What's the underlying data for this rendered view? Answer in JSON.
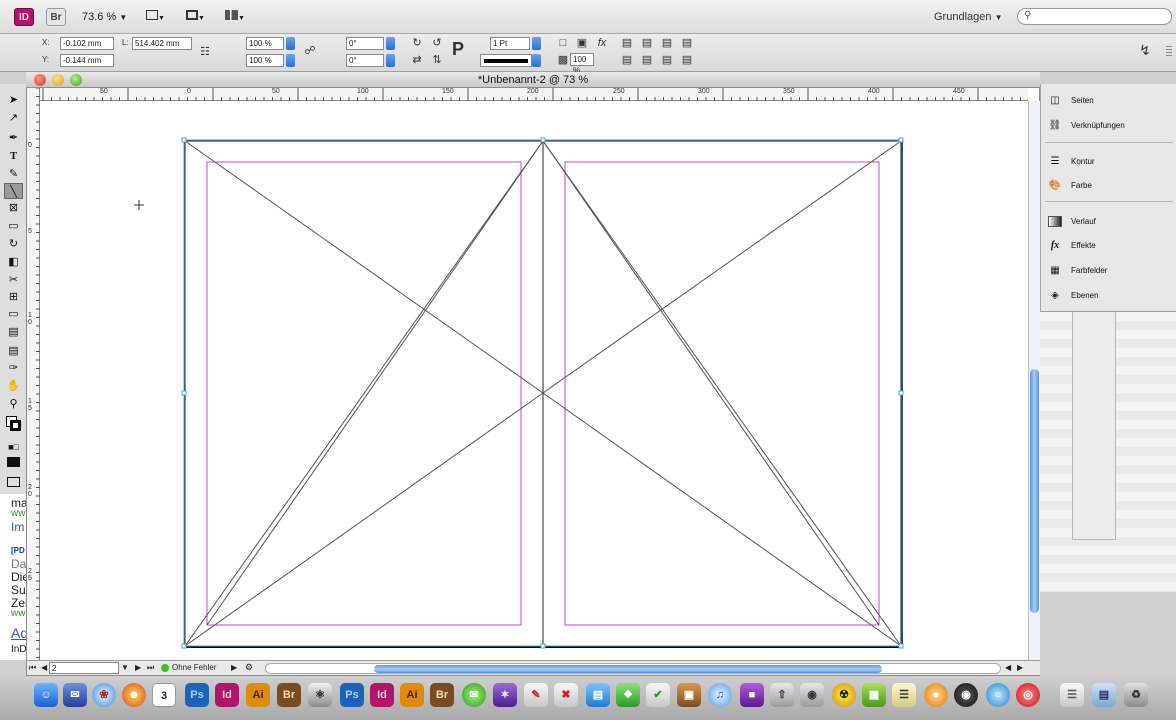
{
  "appbar": {
    "app_icon": "ID",
    "bridge_icon": "Br",
    "zoom": "73.6 %",
    "workspace": "Grundlagen",
    "search_placeholder": ""
  },
  "control": {
    "x_label": "X:",
    "x_value": "-0.102 mm",
    "y_label": "Y:",
    "y_value": "-0.144 mm",
    "l_label": "L:",
    "l_value": "514.402 mm",
    "scale_x": "100 %",
    "scale_y": "100 %",
    "angle1": "0°",
    "angle2": "0°",
    "stroke": "1 Pt",
    "opacity": "100 %"
  },
  "document": {
    "title": "*Unbenannt-2 @ 73 %",
    "ruler_h": [
      "50",
      "0",
      "50",
      "100",
      "150",
      "200",
      "250",
      "300",
      "350",
      "400",
      "450"
    ],
    "ruler_v": [
      "0",
      "5",
      "1\n0",
      "1\n5",
      "2\n0",
      "2\n5"
    ]
  },
  "status": {
    "page": "2",
    "preflight": "Ohne Fehler"
  },
  "side_text": [
    "ma",
    "ww",
    "Im",
    "[PD",
    "Dal",
    "Die",
    "Sui",
    "Zei",
    "ww",
    "Ad",
    "InD"
  ],
  "panel": {
    "items": [
      {
        "label": "Seiten",
        "icon": "pages-icon"
      },
      {
        "label": "Verknüpfungen",
        "icon": "links-icon"
      },
      {
        "label": "Kontur",
        "icon": "stroke-icon"
      },
      {
        "label": "Farbe",
        "icon": "color-icon"
      },
      {
        "label": "Verlauf",
        "icon": "gradient-icon"
      },
      {
        "label": "Effekte",
        "icon": "effects-icon"
      },
      {
        "label": "Farbfelder",
        "icon": "swatches-icon"
      },
      {
        "label": "Ebenen",
        "icon": "layers-icon"
      }
    ]
  },
  "dock": {
    "calendar_day": "3",
    "items": [
      "Ps",
      "Id",
      "Ai",
      "Br",
      "Ps",
      "Id",
      "Ai",
      "Br"
    ]
  },
  "colors": {
    "margin_guide": "#c940d6",
    "selection": "#4aa3e6",
    "indesign": "#b0156b",
    "illustrator": "#e08a10",
    "photoshop": "#1c64b8",
    "bridge": "#7a4b22"
  }
}
